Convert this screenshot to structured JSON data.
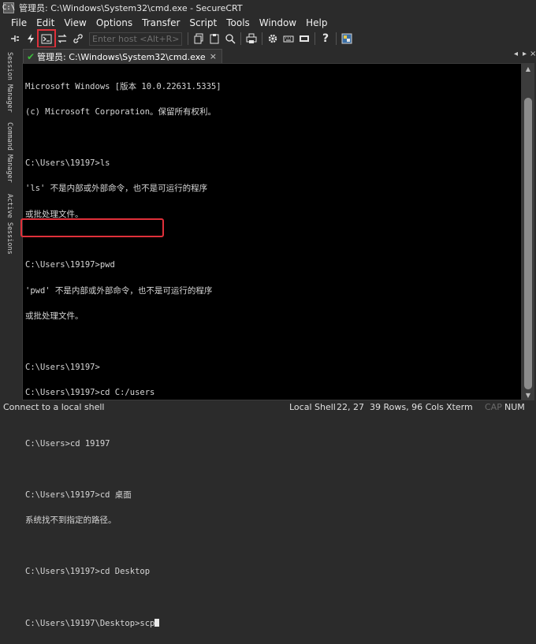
{
  "window": {
    "title": "管理员: C:\\Windows\\System32\\cmd.exe - SecureCRT",
    "app_icon": "C:\\"
  },
  "menu": [
    "File",
    "Edit",
    "View",
    "Options",
    "Transfer",
    "Script",
    "Tools",
    "Window",
    "Help"
  ],
  "toolbar": {
    "enter_host_placeholder": "Enter host <Alt+R>"
  },
  "side_tabs": [
    "Session Manager",
    "Command Manager",
    "Active Sessions"
  ],
  "session_tab": {
    "label": "管理员: C:\\Windows\\System32\\cmd.exe",
    "close": "×"
  },
  "tab_nav": {
    "prev": "◂",
    "next": "▸",
    "close": "×"
  },
  "terminal": {
    "lines": [
      "Microsoft Windows [版本 10.0.22631.5335]",
      "(c) Microsoft Corporation。保留所有权利。",
      "",
      "C:\\Users\\19197>ls",
      "'ls' 不是内部或外部命令，也不是可运行的程序",
      "或批处理文件。",
      "",
      "C:\\Users\\19197>pwd",
      "'pwd' 不是内部或外部命令，也不是可运行的程序",
      "或批处理文件。",
      "",
      "C:\\Users\\19197>",
      "C:\\Users\\19197>cd C:/users",
      "",
      "C:\\Users>cd 19197",
      "",
      "C:\\Users\\19197>cd 桌面",
      "系统找不到指定的路径。",
      "",
      "C:\\Users\\19197>cd Desktop",
      "",
      "C:\\Users\\19197\\Desktop>scp"
    ]
  },
  "status": {
    "left": "Connect to a local shell",
    "session_type": "Local Shell",
    "cursor_pos": "22, 27",
    "dimensions": "39 Rows, 96 Cols",
    "term_type": "Xterm",
    "caps": "CAP",
    "num": "NUM"
  },
  "colors": {
    "highlight": "#e0303a",
    "terminal_bg": "#000000",
    "chrome_bg": "#2b2b2b"
  }
}
